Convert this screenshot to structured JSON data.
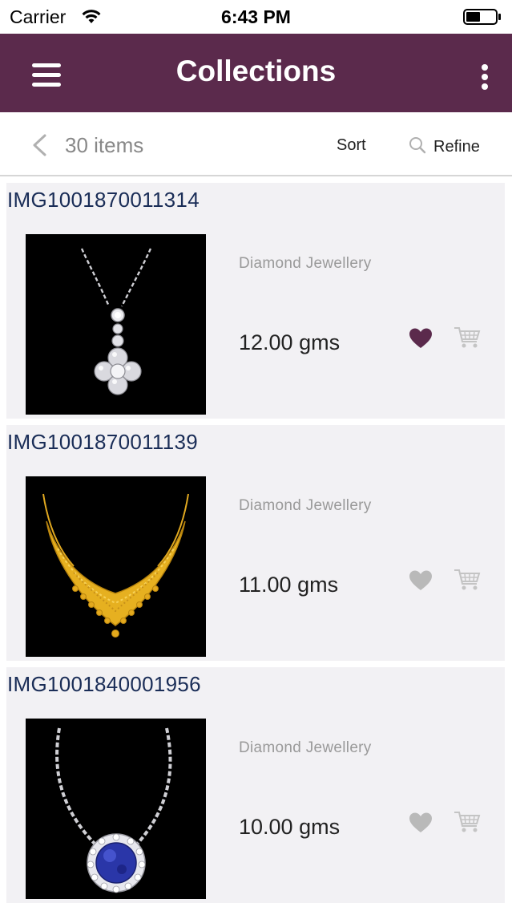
{
  "status_bar": {
    "carrier": "Carrier",
    "time": "6:43 PM"
  },
  "header": {
    "title": "Collections",
    "background_color": "#5b2a4c"
  },
  "toolbar": {
    "items_count": "30 items",
    "sort_label": "Sort",
    "refine_label": "Refine"
  },
  "products": [
    {
      "code": "IMG1001870011314",
      "category": "Diamond Jewellery",
      "weight": "12.00 gms",
      "favorited": true,
      "image": "diamond-pendant-necklace"
    },
    {
      "code": "IMG1001870011139",
      "category": "Diamond Jewellery",
      "weight": "11.00 gms",
      "favorited": false,
      "image": "gold-bib-necklace"
    },
    {
      "code": "IMG1001840001956",
      "category": "Diamond Jewellery",
      "weight": "10.00 gms",
      "favorited": false,
      "image": "sapphire-halo-pendant"
    }
  ],
  "colors": {
    "favorite_active": "#5b2a4c",
    "favorite_inactive": "#b9b9b9",
    "code_text": "#1a2d57"
  }
}
